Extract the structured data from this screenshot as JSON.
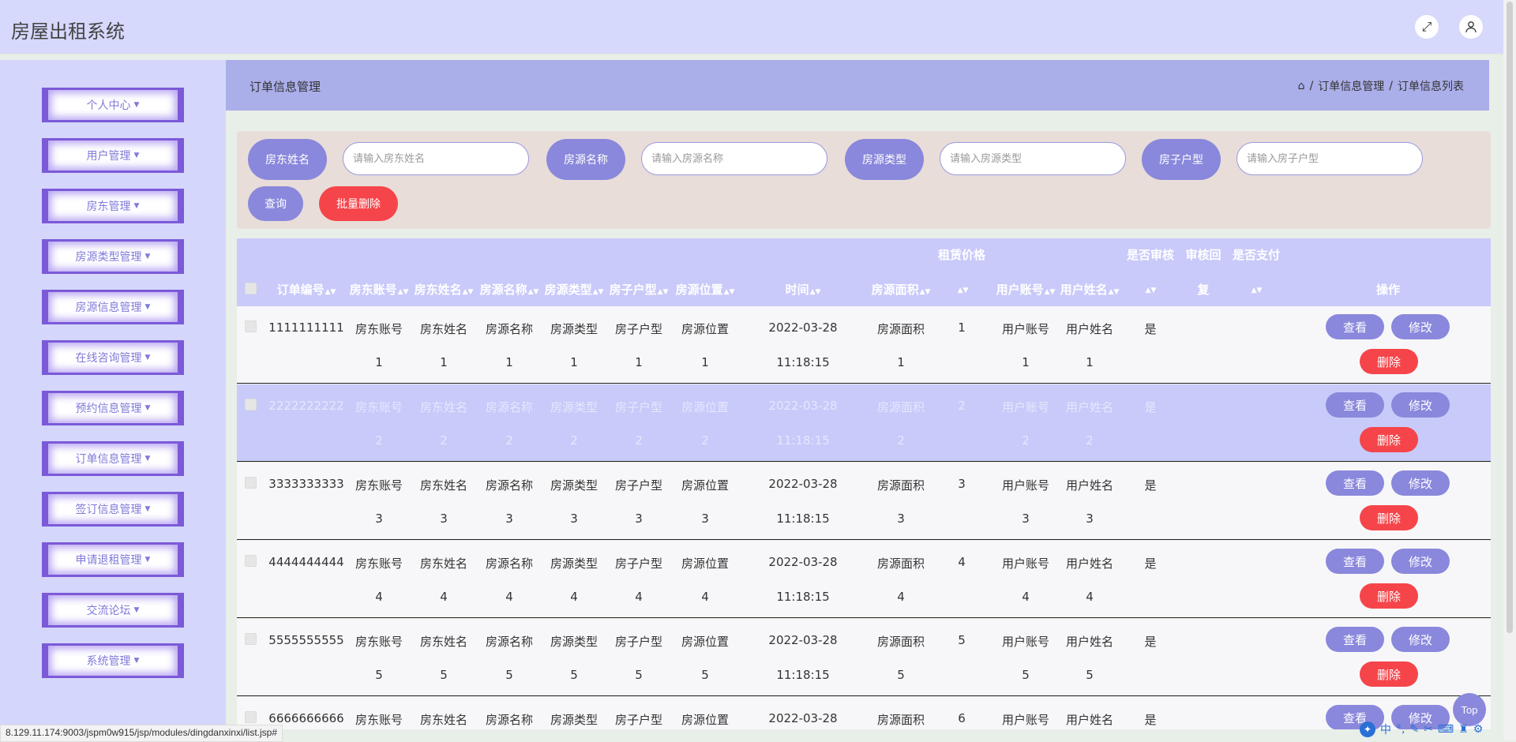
{
  "app": {
    "title": "房屋出租系统"
  },
  "header_icons": {
    "fullscreen": "expand-icon",
    "user": "user-icon"
  },
  "sidebar": {
    "items": [
      {
        "label": "个人中心"
      },
      {
        "label": "用户管理"
      },
      {
        "label": "房东管理"
      },
      {
        "label": "房源类型管理"
      },
      {
        "label": "房源信息管理"
      },
      {
        "label": "在线咨询管理"
      },
      {
        "label": "预约信息管理"
      },
      {
        "label": "订单信息管理"
      },
      {
        "label": "签订信息管理"
      },
      {
        "label": "申请退租管理"
      },
      {
        "label": "交流论坛"
      },
      {
        "label": "系统管理"
      }
    ]
  },
  "page": {
    "title": "订单信息管理",
    "breadcrumb": [
      "订单信息管理",
      "订单信息列表"
    ],
    "separator": "/"
  },
  "search": {
    "fields": [
      {
        "label": "房东姓名",
        "placeholder": "请输入房东姓名"
      },
      {
        "label": "房源名称",
        "placeholder": "请输入房源名称"
      },
      {
        "label": "房源类型",
        "placeholder": "请输入房源类型"
      },
      {
        "label": "房子户型",
        "placeholder": "请输入房子户型"
      }
    ],
    "query_label": "查询",
    "batch_delete_label": "批量删除"
  },
  "table": {
    "columns": {
      "order_no": "订单编号",
      "landlord_account": "房东账号",
      "landlord_name": "房东姓名",
      "house_name": "房源名称",
      "house_type": "房源类型",
      "house_layout": "房子户型",
      "house_location": "房源位置",
      "rent_price": "租赁价格",
      "time": "时间",
      "house_area": "房源面积",
      "user_account": "用户账号",
      "user_name": "用户姓名",
      "is_reviewed": "是否审核",
      "review_reply_a": "审核回",
      "review_reply_b": "复",
      "is_paid": "是否支付",
      "actions": "操作"
    },
    "rows": [
      {
        "order_no": "1111111111",
        "la": "房东账号",
        "ln": "房东姓名",
        "hn": "房源名称",
        "ht": "房源类型",
        "hl": "房子户型",
        "loc": "房源位置",
        "num": "1",
        "date": "2022-03-28",
        "clock": "11:18:15",
        "area": "房源面积",
        "price": "1",
        "ua": "用户账号",
        "un": "用户姓名",
        "reviewed": "是"
      },
      {
        "order_no": "2222222222",
        "la": "房东账号",
        "ln": "房东姓名",
        "hn": "房源名称",
        "ht": "房源类型",
        "hl": "房子户型",
        "loc": "房源位置",
        "num": "2",
        "date": "2022-03-28",
        "clock": "11:18:15",
        "area": "房源面积",
        "price": "2",
        "ua": "用户账号",
        "un": "用户姓名",
        "reviewed": "是"
      },
      {
        "order_no": "3333333333",
        "la": "房东账号",
        "ln": "房东姓名",
        "hn": "房源名称",
        "ht": "房源类型",
        "hl": "房子户型",
        "loc": "房源位置",
        "num": "3",
        "date": "2022-03-28",
        "clock": "11:18:15",
        "area": "房源面积",
        "price": "3",
        "ua": "用户账号",
        "un": "用户姓名",
        "reviewed": "是"
      },
      {
        "order_no": "4444444444",
        "la": "房东账号",
        "ln": "房东姓名",
        "hn": "房源名称",
        "ht": "房源类型",
        "hl": "房子户型",
        "loc": "房源位置",
        "num": "4",
        "date": "2022-03-28",
        "clock": "11:18:15",
        "area": "房源面积",
        "price": "4",
        "ua": "用户账号",
        "un": "用户姓名",
        "reviewed": "是"
      },
      {
        "order_no": "5555555555",
        "la": "房东账号",
        "ln": "房东姓名",
        "hn": "房源名称",
        "ht": "房源类型",
        "hl": "房子户型",
        "loc": "房源位置",
        "num": "5",
        "date": "2022-03-28",
        "clock": "11:18:15",
        "area": "房源面积",
        "price": "5",
        "ua": "用户账号",
        "un": "用户姓名",
        "reviewed": "是"
      },
      {
        "order_no": "6666666666",
        "la": "房东账号",
        "ln": "房东姓名",
        "hn": "房源名称",
        "ht": "房源类型",
        "hl": "房子户型",
        "loc": "房源位置",
        "num": "6",
        "date": "2022-03-28",
        "clock": "",
        "area": "房源面积",
        "price": "6",
        "ua": "用户账号",
        "un": "用户姓名",
        "reviewed": "是"
      }
    ],
    "view_label": "查看",
    "edit_label": "修改",
    "delete_label": "删除"
  },
  "status_url": "8.129.11.174:9003/jspm0w915/jsp/modules/dingdanxinxi/list.jsp#",
  "top_button": "Top",
  "ime_bar": {
    "lang": "中"
  },
  "colors": {
    "accent": "#8a88dc",
    "danger": "#f5454a",
    "header_bg": "#d6d8fc",
    "sidebar_bg": "#d4d6fb",
    "menu_border": "#7b5ad8"
  }
}
